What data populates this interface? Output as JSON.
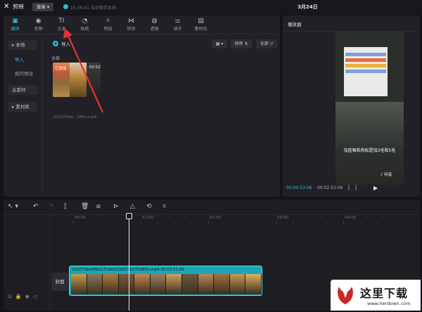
{
  "titlebar": {
    "app_name": "剪映",
    "menu_label": "菜单",
    "save_status": "15:36:41 自动保存本地",
    "date": "3月24日"
  },
  "toolbar": {
    "tools": [
      {
        "label": "媒体",
        "icon": "media-icon",
        "glyph": "▣",
        "active": true
      },
      {
        "label": "音频",
        "icon": "audio-icon",
        "glyph": "◉",
        "active": false
      },
      {
        "label": "文本",
        "icon": "text-icon",
        "glyph": "TI",
        "active": false
      },
      {
        "label": "贴纸",
        "icon": "sticker-icon",
        "glyph": "◔",
        "active": false
      },
      {
        "label": "特效",
        "icon": "effects-icon",
        "glyph": "✧",
        "active": false
      },
      {
        "label": "转场",
        "icon": "transition-icon",
        "glyph": "⋈",
        "active": false
      },
      {
        "label": "滤镜",
        "icon": "filter-icon",
        "glyph": "◍",
        "active": false
      },
      {
        "label": "调节",
        "icon": "adjust-icon",
        "glyph": "⚌",
        "active": false
      },
      {
        "label": "素材包",
        "icon": "package-icon",
        "glyph": "▤",
        "active": false
      }
    ]
  },
  "sidebar": {
    "local": "▸ 本地",
    "import": "导入",
    "presets": "我的预设",
    "cloud": "云素材",
    "library": "▸ 素材库"
  },
  "media": {
    "import_label": "导入",
    "sort_label": "排序",
    "filter_label": "全部",
    "all_label": "全部",
    "clip": {
      "added_label": "已添加",
      "duration": "02:52",
      "filename": "02237bbe...385e.mp4"
    }
  },
  "player": {
    "title": "播放器",
    "caption": "加蓝莓和肉松是加3毛和5毛",
    "watermark": "抖音",
    "current_time": "00:00:53:06",
    "total_time": "00:02:51:06"
  },
  "timeline": {
    "ticks": [
      "00:00",
      "01:00",
      "02:00",
      "03:00",
      "04:00"
    ],
    "cover_label": "封面",
    "track_label": "02237bbe6fba17cbbd21b923b376385e.mp4  00:02:51:06",
    "thumb_colors": [
      "#c89a48",
      "#8a7a5a",
      "#b07a3c",
      "#7a5a3a",
      "#c2864a",
      "#9a8060",
      "#d0a060",
      "#6a5a40",
      "#b88a50",
      "#a07040",
      "#c89858",
      "#e0b060"
    ]
  },
  "watermark": {
    "title": "这里下载",
    "url": "www.herdown.com"
  }
}
